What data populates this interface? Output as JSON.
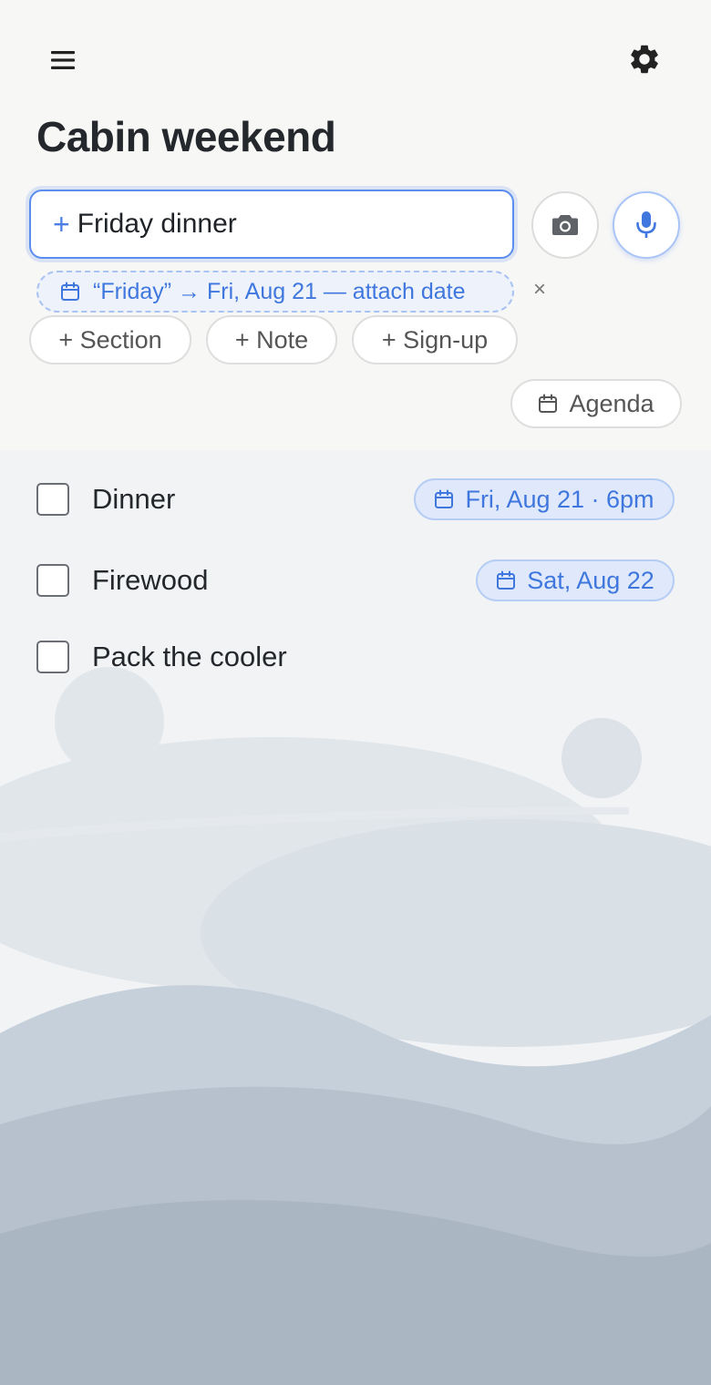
{
  "header": {
    "menu_icon": "hamburger-menu-icon",
    "settings_icon": "gear-icon",
    "title": "Cabin weekend"
  },
  "composer": {
    "plus": "+",
    "value": "Friday dinner",
    "camera_icon": "camera-icon",
    "mic_icon": "microphone-icon",
    "accent": "#5b8def"
  },
  "suggestion": {
    "text": "“Friday” → Fri, Aug 21 — attach date",
    "dismiss": "×"
  },
  "chips": {
    "section": "+ Section",
    "note": "+ Note",
    "signup": "+ Sign-up",
    "agenda": "Agenda"
  },
  "items": [
    {
      "label": "Dinner",
      "date": "Fri, Aug 21 · 6pm",
      "checked": false
    },
    {
      "label": "Firewood",
      "date": "Sat, Aug 22",
      "checked": false
    },
    {
      "label": "Pack the cooler",
      "checked": false
    }
  ]
}
